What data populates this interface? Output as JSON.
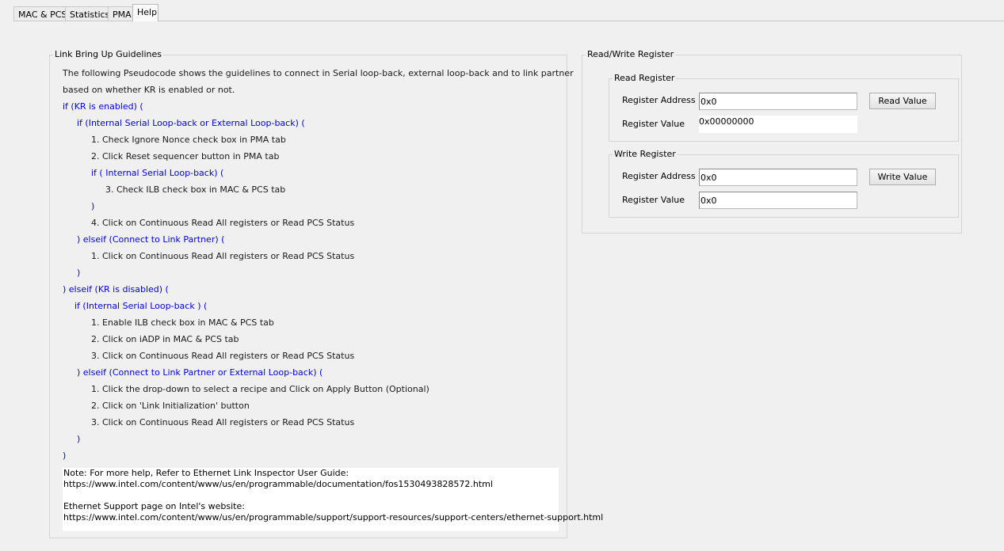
{
  "tabs": [
    {
      "label": "MAC & PCS"
    },
    {
      "label": "Statistics"
    },
    {
      "label": "PMA"
    },
    {
      "label": "Help"
    }
  ],
  "guidelines": {
    "title": "Link Bring Up Guidelines",
    "lines": [
      {
        "text": "The following Pseudocode shows the guidelines to connect in Serial loop-back, external loop-back and to link partner",
        "color": "black"
      },
      {
        "text": "based on whether KR is enabled or not.",
        "color": "black"
      },
      {
        "text": "if (KR is enabled) (",
        "color": "blue"
      },
      {
        "text": "if (Internal Serial Loop-back or External Loop-back) (",
        "color": "blue"
      },
      {
        "text": "1. Check Ignore Nonce check box in PMA tab",
        "color": "black"
      },
      {
        "text": "2. Click Reset sequencer button in PMA tab",
        "color": "black"
      },
      {
        "text": "if ( Internal Serial Loop-back) (",
        "color": "blue"
      },
      {
        "text": "3. Check ILB check box in MAC & PCS tab",
        "color": "black"
      },
      {
        "text": ")",
        "color": "blue"
      },
      {
        "text": "4. Click on Continuous Read All registers or Read PCS Status",
        "color": "black"
      },
      {
        "text": ") elseif (Connect to Link Partner) (",
        "color": "blue"
      },
      {
        "text": "1. Click on Continuous Read All registers or Read PCS Status",
        "color": "black"
      },
      {
        "text": ")",
        "color": "blue"
      },
      {
        "text": ") elseif (KR is disabled) (",
        "color": "blue"
      },
      {
        "text": "if (Internal Serial Loop-back ) (",
        "color": "blue"
      },
      {
        "text": "1. Enable ILB check box in MAC & PCS tab",
        "color": "black"
      },
      {
        "text": "2. Click on iADP in MAC & PCS tab",
        "color": "black"
      },
      {
        "text": "3. Click on Continuous Read All registers or Read PCS Status",
        "color": "black"
      },
      {
        "text": ") elseif (Connect to Link Partner or External Loop-back) (",
        "color": "blue"
      },
      {
        "text": "1. Click the drop-down to select a recipe and Click on Apply Button (Optional)",
        "color": "black"
      },
      {
        "text": "2. Click on 'Link Initialization' button",
        "color": "black"
      },
      {
        "text": "3. Click on Continuous Read All registers or Read PCS Status",
        "color": "black"
      },
      {
        "text": ")",
        "color": "blue"
      },
      {
        "text": ")",
        "color": "blue"
      }
    ],
    "note": {
      "line1": "Note: For more help, Refer to Ethernet Link Inspector User Guide:",
      "line2": "https://www.intel.com/content/www/us/en/programmable/documentation/fos1530493828572.html",
      "line3": "Ethernet Support page on Intel's website:",
      "line4": "https://www.intel.com/content/www/us/en/programmable/support/support-resources/support-centers/ethernet-support.html"
    }
  },
  "register": {
    "title": "Read/Write Register",
    "read": {
      "title": "Read Register",
      "address_label": "Register Address",
      "address_value": "0x0",
      "value_label": "Register Value",
      "value": "0x00000000",
      "button": "Read Value"
    },
    "write": {
      "title": "Write Register",
      "address_label": "Register Address",
      "address_value": "0x0",
      "value_label": "Register Value",
      "value": "0x0",
      "button": "Write Value"
    }
  },
  "colors": {
    "blue_text": "#0000e6",
    "background": "#f0f0f0"
  }
}
